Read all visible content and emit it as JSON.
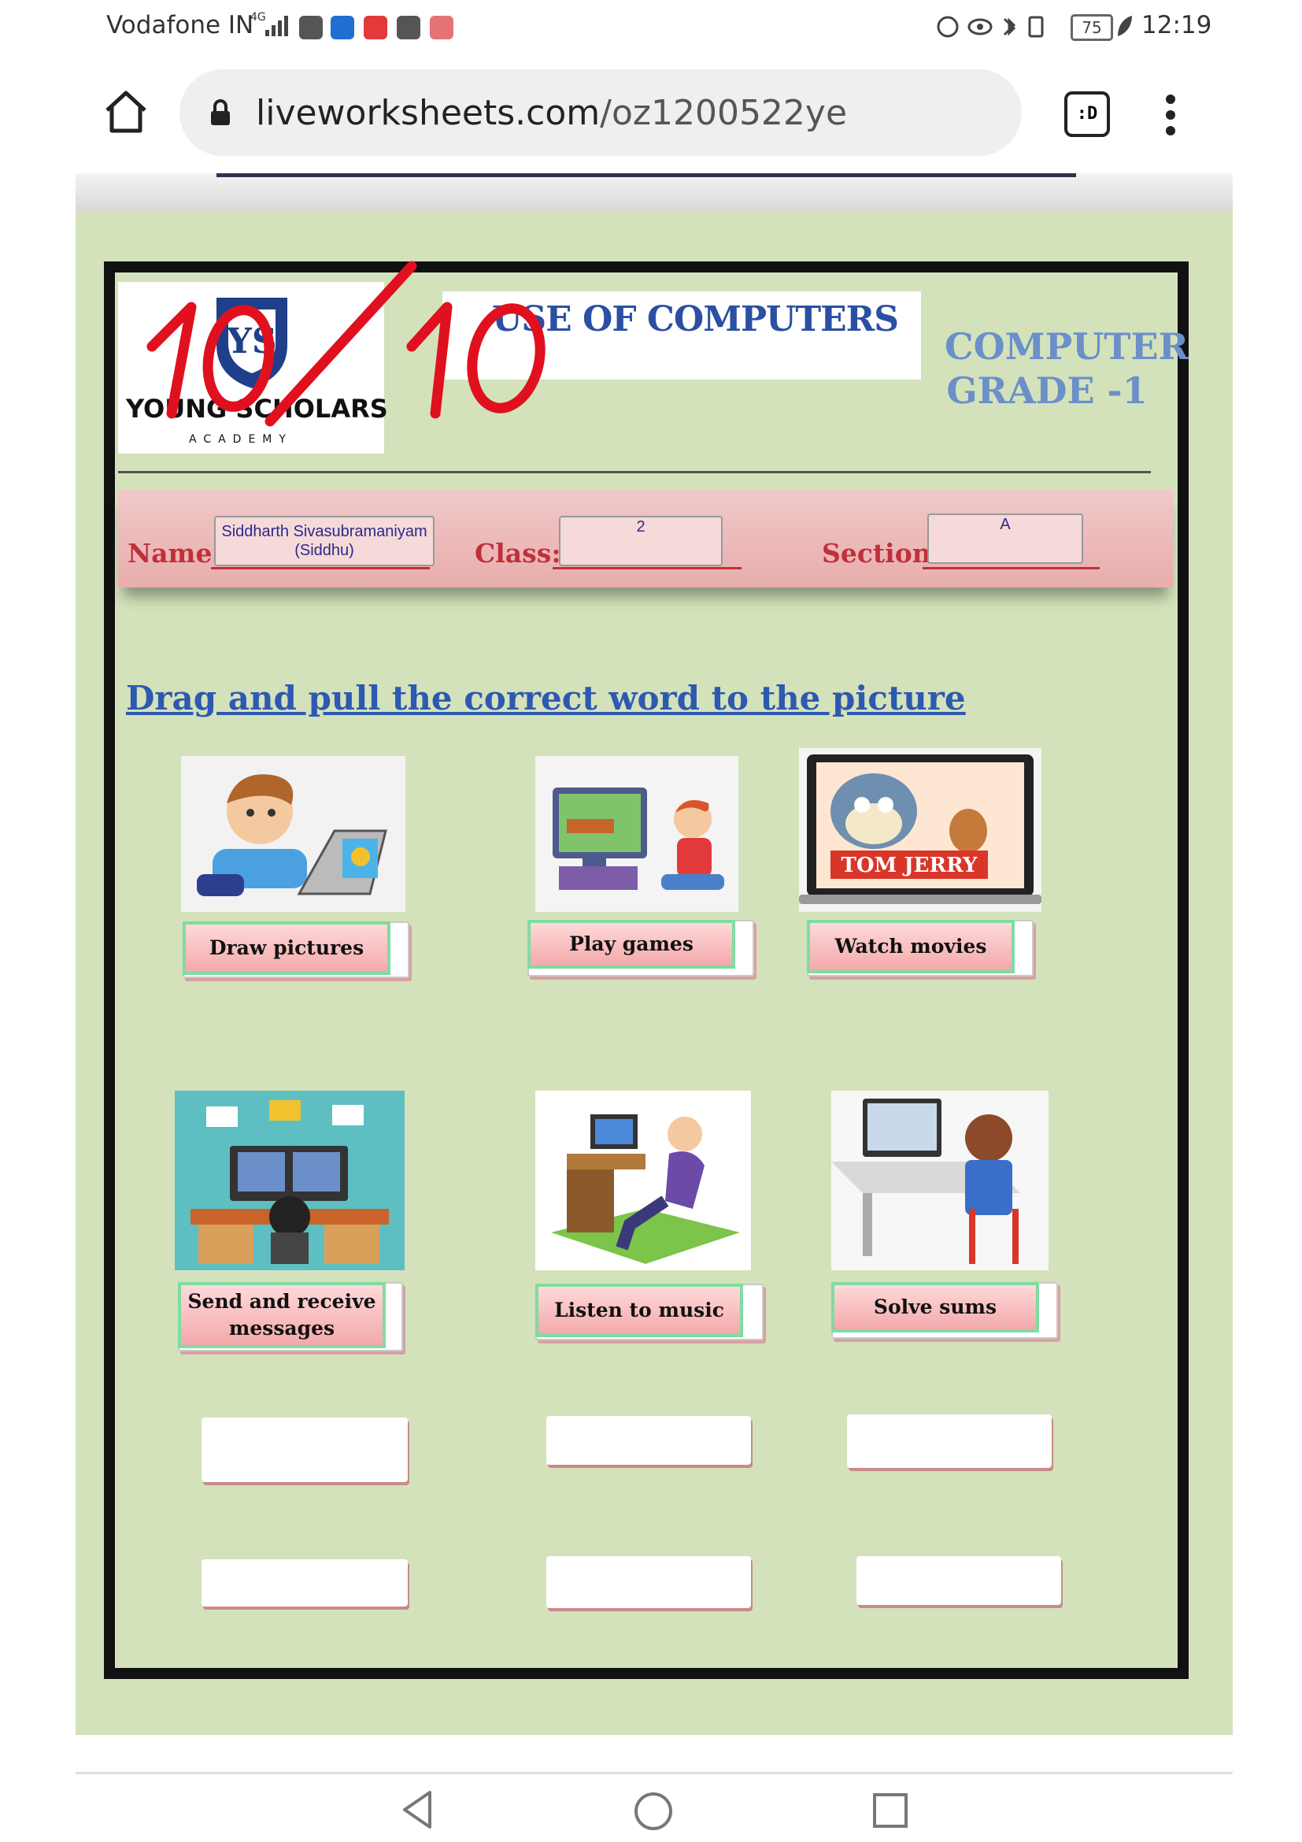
{
  "status_bar": {
    "carrier": "Vodafone IN",
    "network": "4G",
    "battery": "75",
    "time": "12:19"
  },
  "browser": {
    "url_domain": "liveworksheets.com",
    "url_path": "/oz1200522ye",
    "tabs_label": ":D"
  },
  "worksheet": {
    "logo_text": "YOUNG SCHOLARS",
    "logo_sub": "ACADEMY",
    "title": "USE OF COMPUTERS",
    "subject_line1": "COMPUTER",
    "subject_line2": "GRADE -1",
    "score": "10/10",
    "name_label": "Name:",
    "name_value": "Siddharth Sivasubramaniyam (Siddhu)",
    "class_label": "Class:",
    "class_value": "2",
    "section_label": "Section:",
    "section_value": "A",
    "instruction": "Drag and pull the correct word to the picture",
    "items": [
      {
        "label": "Draw pictures",
        "picture": "boy-with-laptop"
      },
      {
        "label": "Play games",
        "picture": "child-playing-video-game"
      },
      {
        "label": "Watch movies",
        "picture": "tom-and-jerry-on-laptop"
      },
      {
        "label": "Send and receive messages",
        "picture": "desk-with-emails"
      },
      {
        "label": "Listen to music",
        "picture": "man-relaxing-at-desk"
      },
      {
        "label": "Solve sums",
        "picture": "child-at-computer"
      }
    ],
    "cartoon_logo_text": "TOM JERRY"
  },
  "colors": {
    "worksheet_bg": "#d3e2bb",
    "title_blue": "#2a4fa3",
    "label_red": "#c0303a",
    "score_red": "#e0101e",
    "word_border_green": "#7fdca0"
  }
}
